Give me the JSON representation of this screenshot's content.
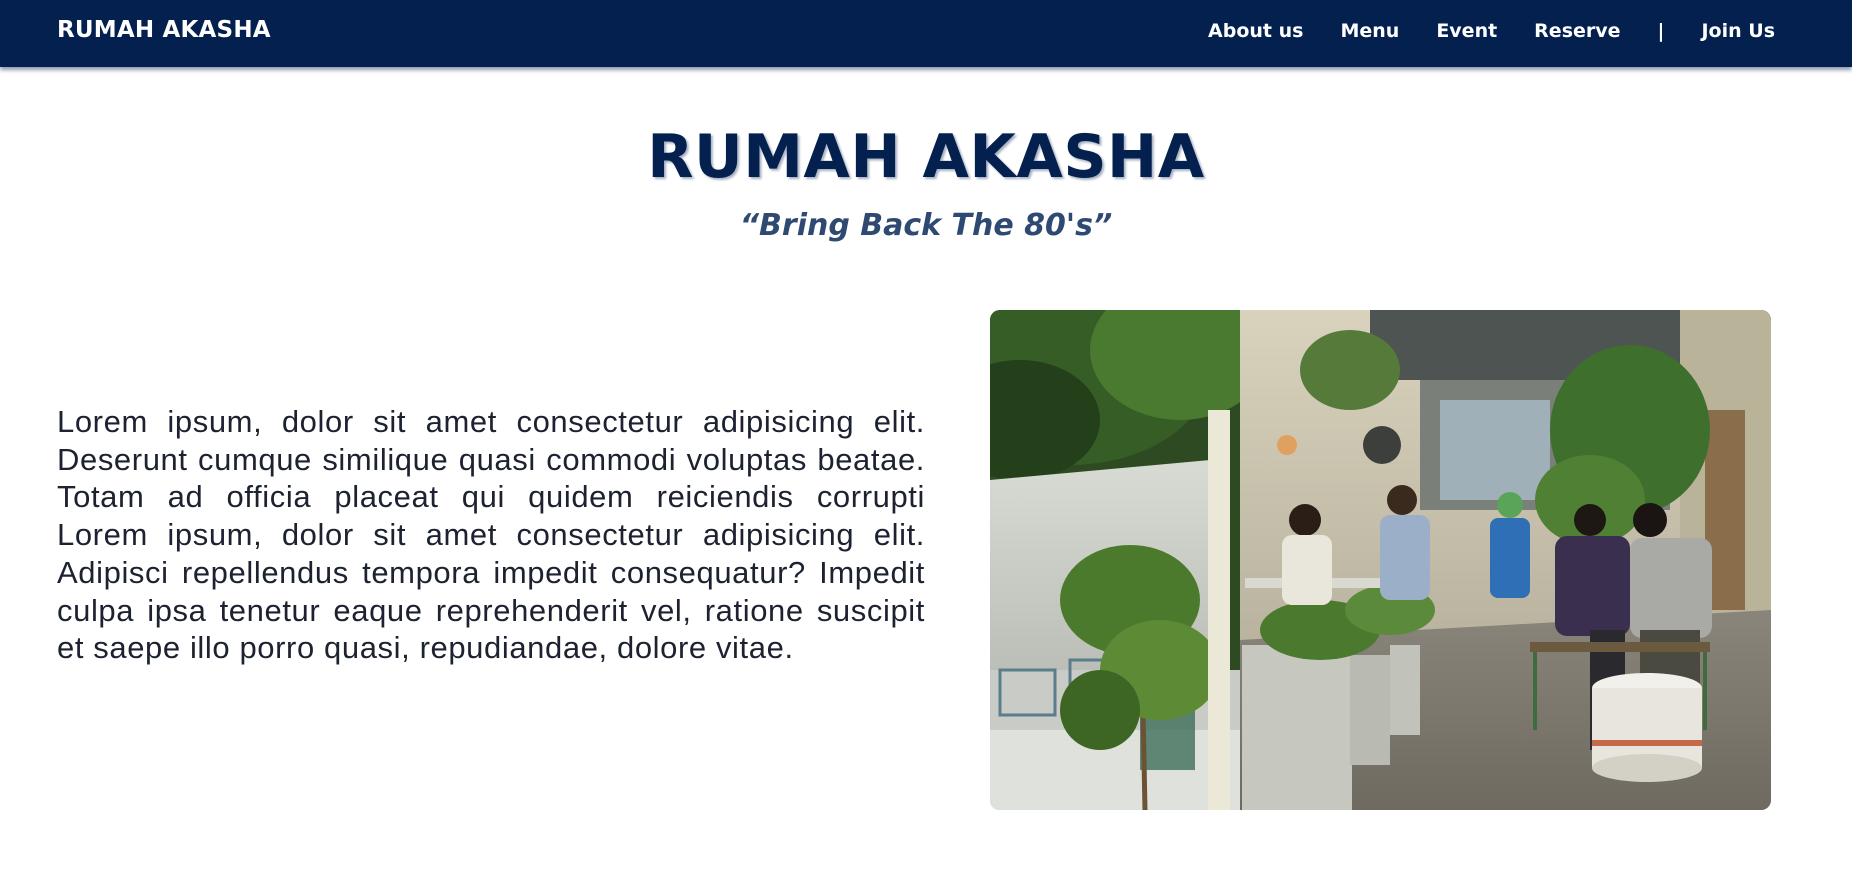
{
  "navbar": {
    "brand": "RUMAH AKASHA",
    "links": [
      {
        "label": "About us"
      },
      {
        "label": "Menu"
      },
      {
        "label": "Event"
      },
      {
        "label": "Reserve"
      }
    ],
    "separator": "|",
    "join_label": "Join Us"
  },
  "hero": {
    "title": "RUMAH AKASHA",
    "subtitle": "“Bring Back The 80's”"
  },
  "about": {
    "text": "Lorem ipsum, dolor sit amet consectetur adipisicing elit. Deserunt cumque similique quasi commodi voluptas beatae. Totam ad officia placeat qui quidem reiciendis corrupti Lorem ipsum, dolor sit amet consectetur adipisicing elit. Adipisci repellendus tempora impedit consequatur? Impedit culpa ipsa tenetur eaque reprehenderit vel, ratione suscipit et saepe illo porro quasi, repudiandae, dolore vitae."
  },
  "colors": {
    "navbar_bg": "#03204f",
    "title": "#03204f",
    "subtitle": "#2e4a72",
    "body_text": "#1d2230"
  }
}
